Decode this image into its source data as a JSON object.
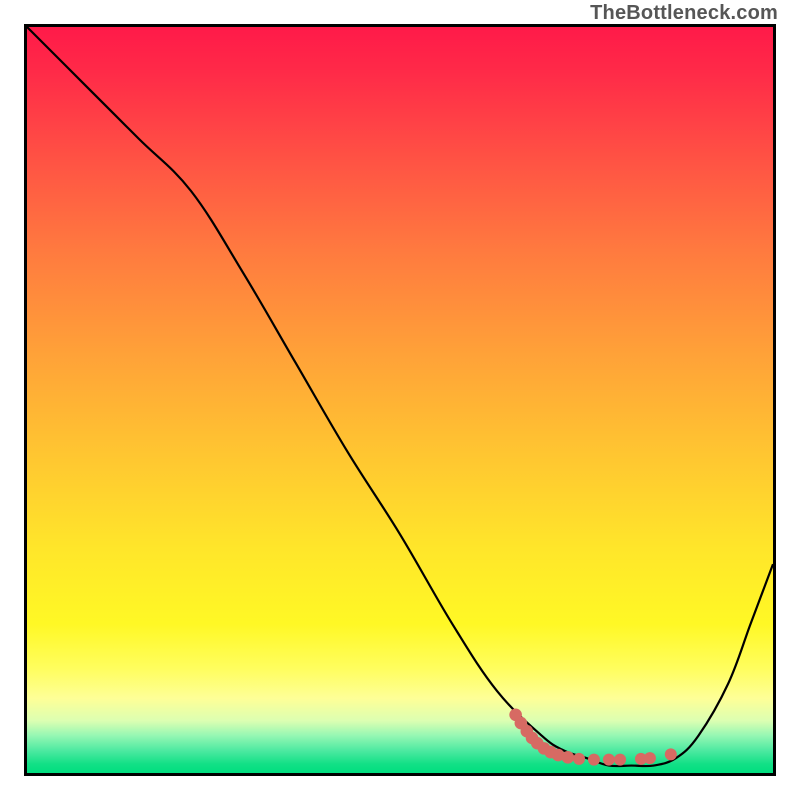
{
  "attribution": "TheBottleneck.com",
  "chart_data": {
    "type": "line",
    "title": "",
    "xlabel": "",
    "ylabel": "",
    "xlim": [
      0,
      100
    ],
    "ylim": [
      0,
      100
    ],
    "series": [
      {
        "name": "curve",
        "x": [
          0,
          8,
          15,
          22,
          29,
          36,
          43,
          50,
          57,
          63,
          69,
          72,
          75,
          78,
          81,
          84,
          87,
          90,
          94,
          97,
          100
        ],
        "values": [
          100,
          92,
          85,
          78,
          67,
          55,
          43,
          32,
          20,
          11,
          5,
          3,
          2,
          1,
          1,
          1,
          2,
          5,
          12,
          20,
          28
        ]
      }
    ],
    "annotations": {
      "dotted_segment": {
        "name": "highlight-dots",
        "color": "#d76a63",
        "points": [
          {
            "x": 65.5,
            "y": 7.8
          },
          {
            "x": 66.2,
            "y": 6.7
          },
          {
            "x": 67.0,
            "y": 5.6
          },
          {
            "x": 67.7,
            "y": 4.7
          },
          {
            "x": 68.4,
            "y": 4.0
          },
          {
            "x": 69.3,
            "y": 3.3
          },
          {
            "x": 70.2,
            "y": 2.8
          },
          {
            "x": 71.2,
            "y": 2.4
          },
          {
            "x": 72.5,
            "y": 2.1
          },
          {
            "x": 74.0,
            "y": 1.9
          },
          {
            "x": 76.0,
            "y": 1.8
          },
          {
            "x": 78.0,
            "y": 1.8
          },
          {
            "x": 79.5,
            "y": 1.8
          },
          {
            "x": 82.3,
            "y": 1.9
          },
          {
            "x": 83.5,
            "y": 2.0
          },
          {
            "x": 86.3,
            "y": 2.5
          }
        ]
      }
    },
    "background_gradient_stops": [
      {
        "pos": 0.0,
        "color": "#ff1a49"
      },
      {
        "pos": 0.5,
        "color": "#ffc531"
      },
      {
        "pos": 0.85,
        "color": "#fffe5e"
      },
      {
        "pos": 1.0,
        "color": "#00de7f"
      }
    ]
  }
}
